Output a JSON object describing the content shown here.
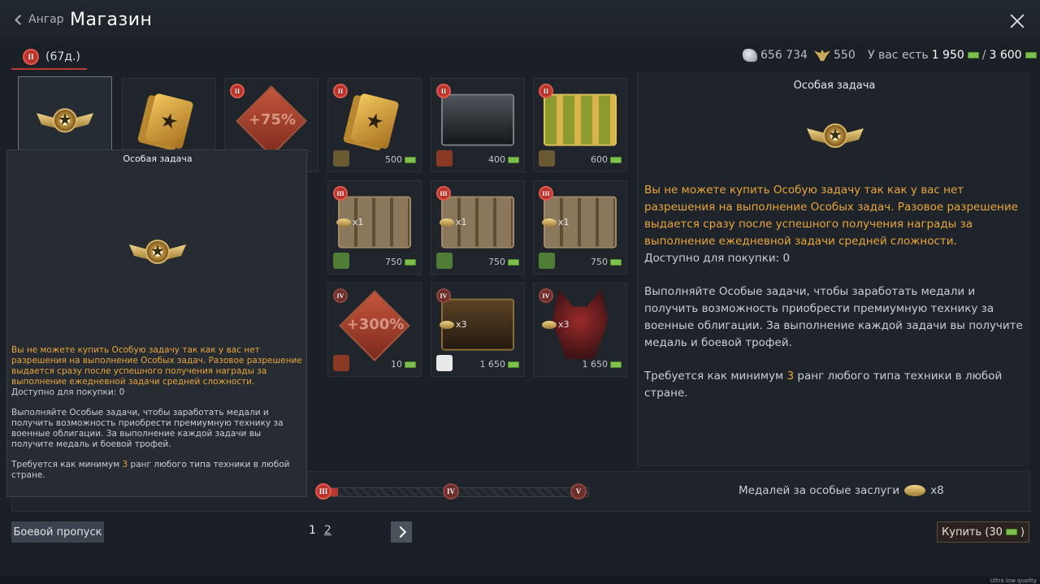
{
  "header": {
    "back_label": "Ангар",
    "separator": "|",
    "title": "Магазин"
  },
  "tab": {
    "rank": "II",
    "label": "(67д.)"
  },
  "currencies": {
    "silver_lions": "656 734",
    "golden_eagles": "550",
    "wallet_prefix": "У вас есть",
    "wallet_have": "1 950",
    "wallet_sep": "/",
    "wallet_total": "3 600"
  },
  "items": [
    {
      "name": "special-task",
      "price": "",
      "rank": ""
    },
    {
      "name": "task-card",
      "price": "",
      "rank": ""
    },
    {
      "name": "booster-75",
      "label": "+75%",
      "price": "",
      "rank": "II"
    },
    {
      "name": "task-card-2",
      "price": "500",
      "rank": "II"
    },
    {
      "name": "black-chest",
      "price": "400",
      "rank": "II"
    },
    {
      "name": "gold-chest",
      "price": "600",
      "rank": "II"
    },
    {
      "name": "crate-1",
      "count": "x1",
      "price": "750",
      "rank": "III"
    },
    {
      "name": "crate-2",
      "count": "x1",
      "price": "750",
      "rank": "III"
    },
    {
      "name": "crate-3",
      "count": "x1",
      "price": "750",
      "rank": "III"
    },
    {
      "name": "booster-300",
      "label": "+300%",
      "price": "10",
      "rank": "IV"
    },
    {
      "name": "dark-chest",
      "count": "x3",
      "price": "1 650",
      "rank": "IV"
    },
    {
      "name": "wolf",
      "count": "x3",
      "price": "1 650",
      "rank": "IV"
    }
  ],
  "panel": {
    "title": "Особая задача",
    "warning": "Вы не можете купить Особую задачу так как у вас нет разрешения на выполнение Особых задач. Разовое разрешение выдается сразу после успешного получения награды за выполнение ежедневной задачи средней сложности.",
    "available": "Доступно для покупки: 0",
    "description": "Выполняйте Особые задачи, чтобы заработать медали и получить возможность приобрести премиумную технику за военные облигации. За выполнение каждой задачи вы получите медаль и боевой трофей.",
    "req_prefix": "Требуется как минимум ",
    "req_rank": "3",
    "req_suffix": " ранг любого типа техники в любой стране."
  },
  "tooltip": {
    "title": "Особая задача"
  },
  "progress": {
    "fill_fraction": 0.06,
    "nodes": [
      "III",
      "IV",
      "V"
    ],
    "medals_label": "Медалей за особые заслуги",
    "medals_count": "x8"
  },
  "footer": {
    "battle_pass": "Боевой пропуск",
    "page_current": "1",
    "page_next": "2",
    "buy_label": "Купить (30",
    "buy_suffix": ")",
    "quality": "Ultra low quality"
  }
}
